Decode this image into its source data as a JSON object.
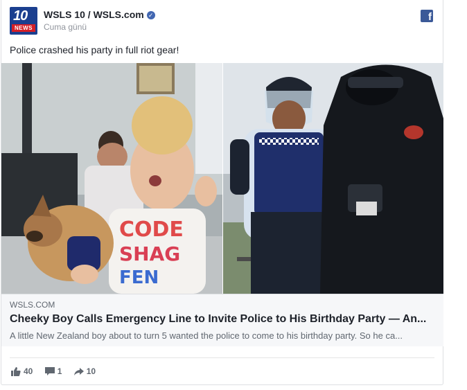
{
  "post": {
    "page_name": "WSLS 10 / WSLS.com",
    "time": "Cuma günü",
    "text": "Police crashed his party in full riot gear!",
    "avatar_number": "10",
    "avatar_label": "NEWS",
    "verified_icon": "check-icon",
    "network_icon": "facebook-icon"
  },
  "link": {
    "source": "WSLS.COM",
    "title": "Cheeky Boy Calls Emergency Line to Invite Police to His Birthday Party — An...",
    "description": "A little New Zealand boy about to turn 5 wanted the police to come to his birthday party. So he ca..."
  },
  "stats": {
    "likes": "40",
    "comments": "1",
    "shares": "10"
  },
  "colors": {
    "brand_blue": "#1b3f8f",
    "facebook_blue": "#3b5998",
    "verified": "#4267b2",
    "news_red": "#d51f27"
  }
}
